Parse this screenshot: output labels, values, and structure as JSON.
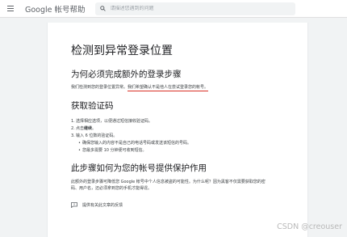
{
  "header": {
    "brand": "Google 帐号帮助",
    "search_placeholder": "请描述您遇到的问题"
  },
  "article": {
    "title": "检测到异常登录位置",
    "section1": {
      "heading": "为何必须完成额外的登录步骤",
      "text_plain": "我们检测到您的登录位置异常。",
      "text_underlined": "我们希望确认不是他人在尝试登录您的帐号。"
    },
    "section2": {
      "heading": "获取验证码",
      "steps": [
        {
          "num": "1.",
          "text": "选择相应选项，以便通过短信接收验证码。"
        },
        {
          "num": "2.",
          "text_prefix": "点击",
          "text_bold": "继续",
          "text_suffix": "。"
        },
        {
          "num": "3.",
          "text": "输入 6 位数的验证码。"
        }
      ],
      "bullets": [
        "确保您输入的内容不是自己的电话号码或发送该短信的号码。",
        "您最多需要 10 分钟便可收到短信。"
      ]
    },
    "section3": {
      "heading": "此步骤如何为您的帐号提供保护作用",
      "line1": "此额外的登录步骤可降低您 Google 帐号中个人信息被盗的可能性。为什么呢？因为黑客不仅需要获取您的密",
      "line2": "码、用户名，还必须拿到您的手机才能得逞。"
    },
    "feedback_label": "提供有关此文章的反馈"
  },
  "watermark": "CSDN @creouser",
  "colors": {
    "underline": "#d93025",
    "page_bg": "#ffffff",
    "outer_bg": "#f1f3f4"
  },
  "icons": {
    "menu": "menu-icon",
    "search": "search-icon",
    "feedback": "feedback-icon"
  }
}
